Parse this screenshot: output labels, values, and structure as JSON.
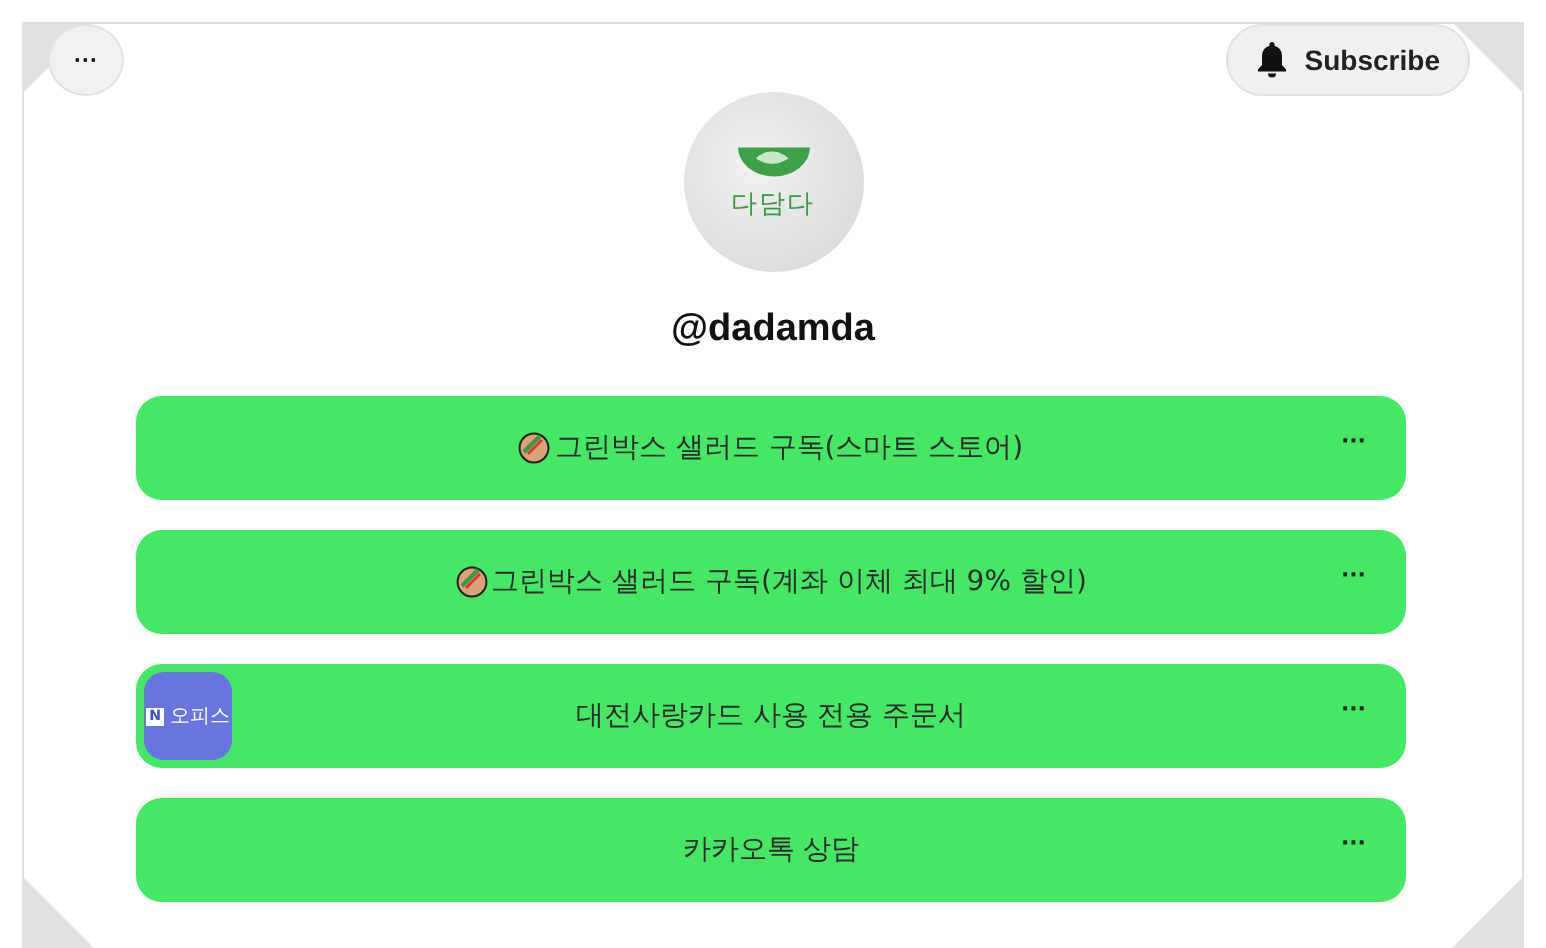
{
  "menu_button": {
    "label": "···"
  },
  "subscribe_button": {
    "label": "Subscribe"
  },
  "profile": {
    "logo_text": "다담다",
    "username": "@dadamda"
  },
  "links": [
    {
      "kind": "emoji",
      "title": "그린박스 샐러드 구독(스마트 스토어)",
      "more": "···"
    },
    {
      "kind": "emoji",
      "title": "그린박스 샐러드 구독(계좌 이체 최대 9% 할인)",
      "more": "···"
    },
    {
      "kind": "thumbnail",
      "thumb_badge": "N",
      "thumb_label": "오피스",
      "title": "대전사랑카드 사용 전용 주문서",
      "more": "···"
    },
    {
      "kind": "plain",
      "title": "카카오톡 상담",
      "more": "···"
    }
  ]
}
